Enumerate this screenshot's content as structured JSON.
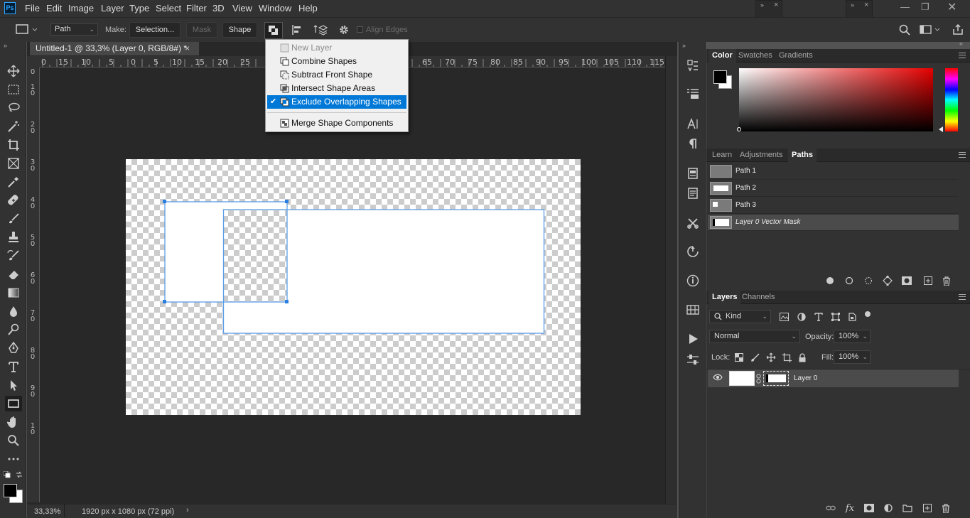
{
  "app": {
    "logo": "Ps"
  },
  "menubar": {
    "items": [
      "File",
      "Edit",
      "Image",
      "Layer",
      "Type",
      "Select",
      "Filter",
      "3D",
      "View",
      "Window",
      "Help"
    ]
  },
  "options": {
    "mode": "Path",
    "make_label": "Make:",
    "selection_btn": "Selection...",
    "mask_btn": "Mask",
    "shape_btn": "Shape",
    "align_edges": "Align Edges"
  },
  "document": {
    "tab_title": "Untitled-1 @ 33,3% (Layer 0, RGB/8#) *",
    "ruler_h": [
      "0",
      "15",
      "10",
      "5",
      "0",
      "5",
      "10",
      "15",
      "20",
      "25",
      "65",
      "70",
      "75",
      "80",
      "85",
      "90",
      "95",
      "100",
      "105",
      "110",
      "115"
    ],
    "ruler_v": [
      "0",
      "1\n0",
      "2\n0",
      "3\n0",
      "4\n0",
      "5\n0",
      "6\n0",
      "7\n0",
      "8\n0",
      "9\n0",
      "1\n0"
    ],
    "zoom": "33,33%",
    "doc_info": "1920 px x 1080 px (72 ppi)"
  },
  "shape_ops_menu": {
    "items": [
      {
        "label": "New Layer",
        "state": "disabled"
      },
      {
        "label": "Combine Shapes",
        "state": "normal"
      },
      {
        "label": "Subtract Front Shape",
        "state": "normal"
      },
      {
        "label": "Intersect Shape Areas",
        "state": "normal"
      },
      {
        "label": "Exclude Overlapping Shapes",
        "state": "selected"
      },
      {
        "label": "Merge Shape Components",
        "state": "normal"
      }
    ],
    "check": "✔"
  },
  "color_panel": {
    "tabs": [
      "Color",
      "Swatches",
      "Gradients"
    ],
    "hue_base": "#e60000"
  },
  "paths_panel": {
    "tabs": [
      "Learn",
      "Adjustments",
      "Paths"
    ],
    "rows": [
      "Path 1",
      "Path 2",
      "Path 3",
      "Layer 0 Vector Mask"
    ]
  },
  "layers_panel": {
    "tabs": [
      "Layers",
      "Channels"
    ],
    "filter": "Kind",
    "blend_mode": "Normal",
    "opacity_label": "Opacity:",
    "opacity_value": "100%",
    "lock_label": "Lock:",
    "fill_label": "Fill:",
    "fill_value": "100%",
    "layer_name": "Layer 0"
  },
  "colors": {
    "accent": "#0078d7",
    "path_stroke": "#4a90e2",
    "fg_color": "#000000",
    "bg_color": "#ffffff"
  }
}
